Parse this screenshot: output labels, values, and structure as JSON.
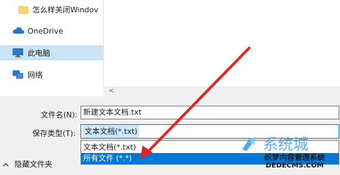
{
  "nav": {
    "items": [
      {
        "label": "怎么样关闭Windov",
        "icon": "folder-icon"
      },
      {
        "label": "OneDrive",
        "icon": "cloud-icon"
      },
      {
        "label": "此电脑",
        "icon": "computer-icon",
        "selected": true
      },
      {
        "label": "网络",
        "icon": "network-icon"
      }
    ]
  },
  "scrollbar": {
    "left_arrow": "<"
  },
  "save_form": {
    "filename_label": "文件名(N):",
    "filename_value": "新建文本文档.txt",
    "filetype_label": "保存类型(T):",
    "filetype_value": "文本文档(*.txt)",
    "filetype_options": [
      "文本文档(*.txt)",
      "所有文件  (*.*)"
    ],
    "highlighted_option_index": 1
  },
  "footer": {
    "hide_folders_label": "隐藏文件夹",
    "hide_folders_icon": "chevron-up-icon"
  },
  "watermark": {
    "name": "织梦内容管理系统",
    "url": "DEDECMS.COM"
  },
  "colors": {
    "selection": "#0078d7",
    "nav_selected": "#cce4f7",
    "arrow": "#e0252b"
  }
}
